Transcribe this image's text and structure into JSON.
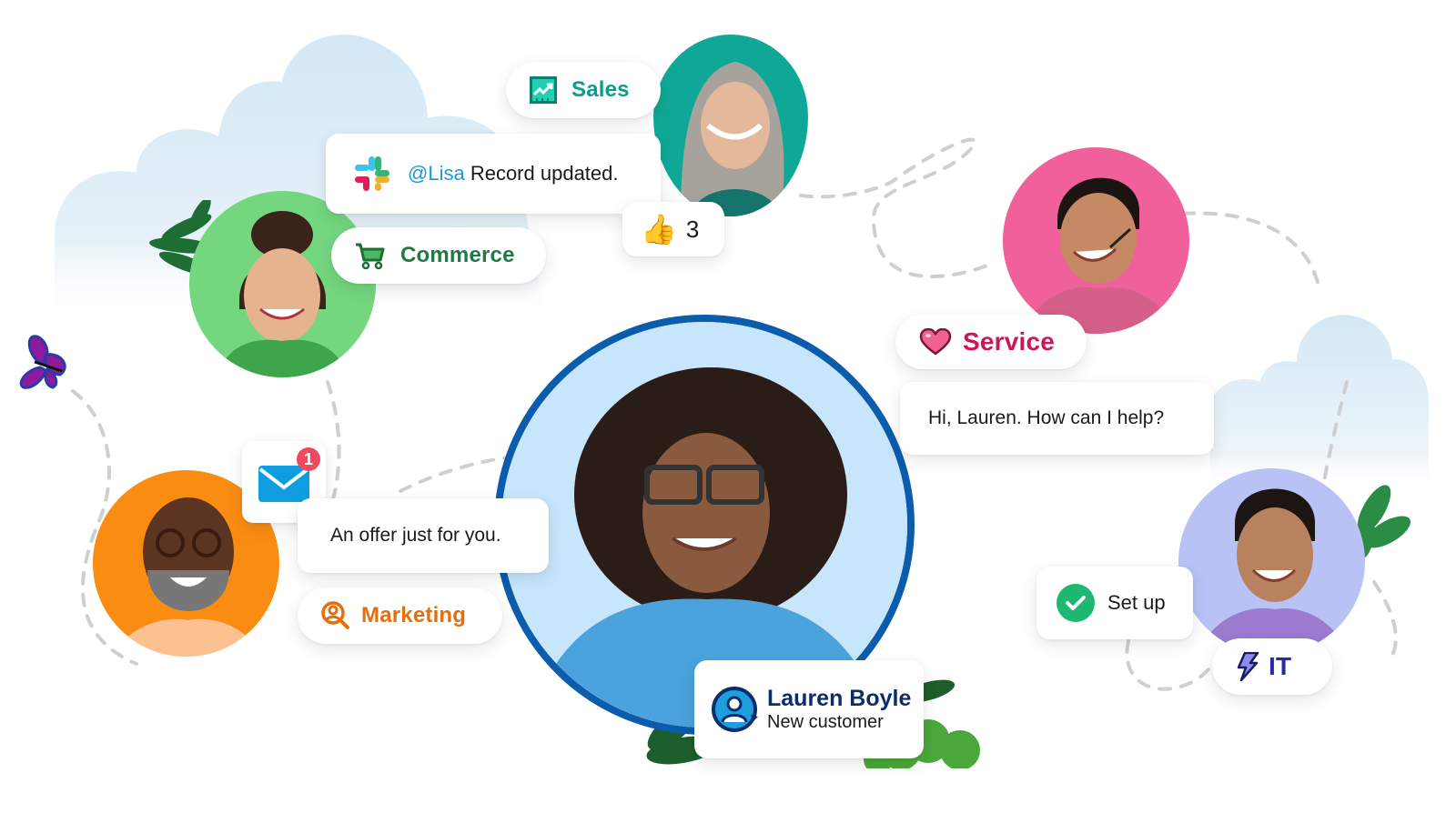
{
  "colors": {
    "sales": "#0b9e8a",
    "commerce": "#1e7a43",
    "service": "#c8175d",
    "marketing": "#e56f0d",
    "it": "#2b2ba8",
    "slack_mention": "#1a9ad9",
    "text_dark": "#1a1a1a",
    "customer_name": "#0b2e6b",
    "cloud": "#d6e9f5",
    "bg_teal": "#0fa896",
    "bg_green": "#74d67f",
    "bg_pink": "#f0609a",
    "bg_orange": "#fb8c12",
    "bg_lavender": "#b8c2f5",
    "bg_center": "#c7e6fb",
    "center_ring": "#0b5cad"
  },
  "badges": {
    "sales": {
      "label": "Sales",
      "icon": "chart-trending-up-icon"
    },
    "commerce": {
      "label": "Commerce",
      "icon": "shopping-cart-icon"
    },
    "service": {
      "label": "Service",
      "icon": "heart-icon"
    },
    "marketing": {
      "label": "Marketing",
      "icon": "magnifier-person-icon"
    },
    "it": {
      "label": "IT",
      "icon": "lightning-bolt-icon"
    }
  },
  "messages": {
    "slack": {
      "mention": "@Lisa",
      "text": "Record updated.",
      "icon": "slack-logo-icon"
    },
    "reaction": {
      "emoji": "👍",
      "count": "3"
    },
    "email": {
      "badge_count": "1",
      "icon": "envelope-icon"
    },
    "offer": {
      "text": "An offer just for you."
    },
    "service_reply": {
      "text": "Hi, Lauren. How can I help?"
    },
    "setup": {
      "text": "Set up",
      "icon": "checkmark-circle-icon"
    }
  },
  "customer": {
    "name": "Lauren Boyle",
    "status": "New customer",
    "icon": "user-refresh-icon"
  },
  "people": [
    {
      "role": "sales",
      "description": "smiling woman with grey hair"
    },
    {
      "role": "commerce",
      "description": "smiling woman in green blazer"
    },
    {
      "role": "service",
      "description": "smiling man with headset"
    },
    {
      "role": "marketing",
      "description": "smiling man with glasses and beard"
    },
    {
      "role": "it",
      "description": "smiling woman in purple shirt"
    },
    {
      "role": "customer",
      "description": "smiling woman with glasses and curly hair"
    }
  ]
}
